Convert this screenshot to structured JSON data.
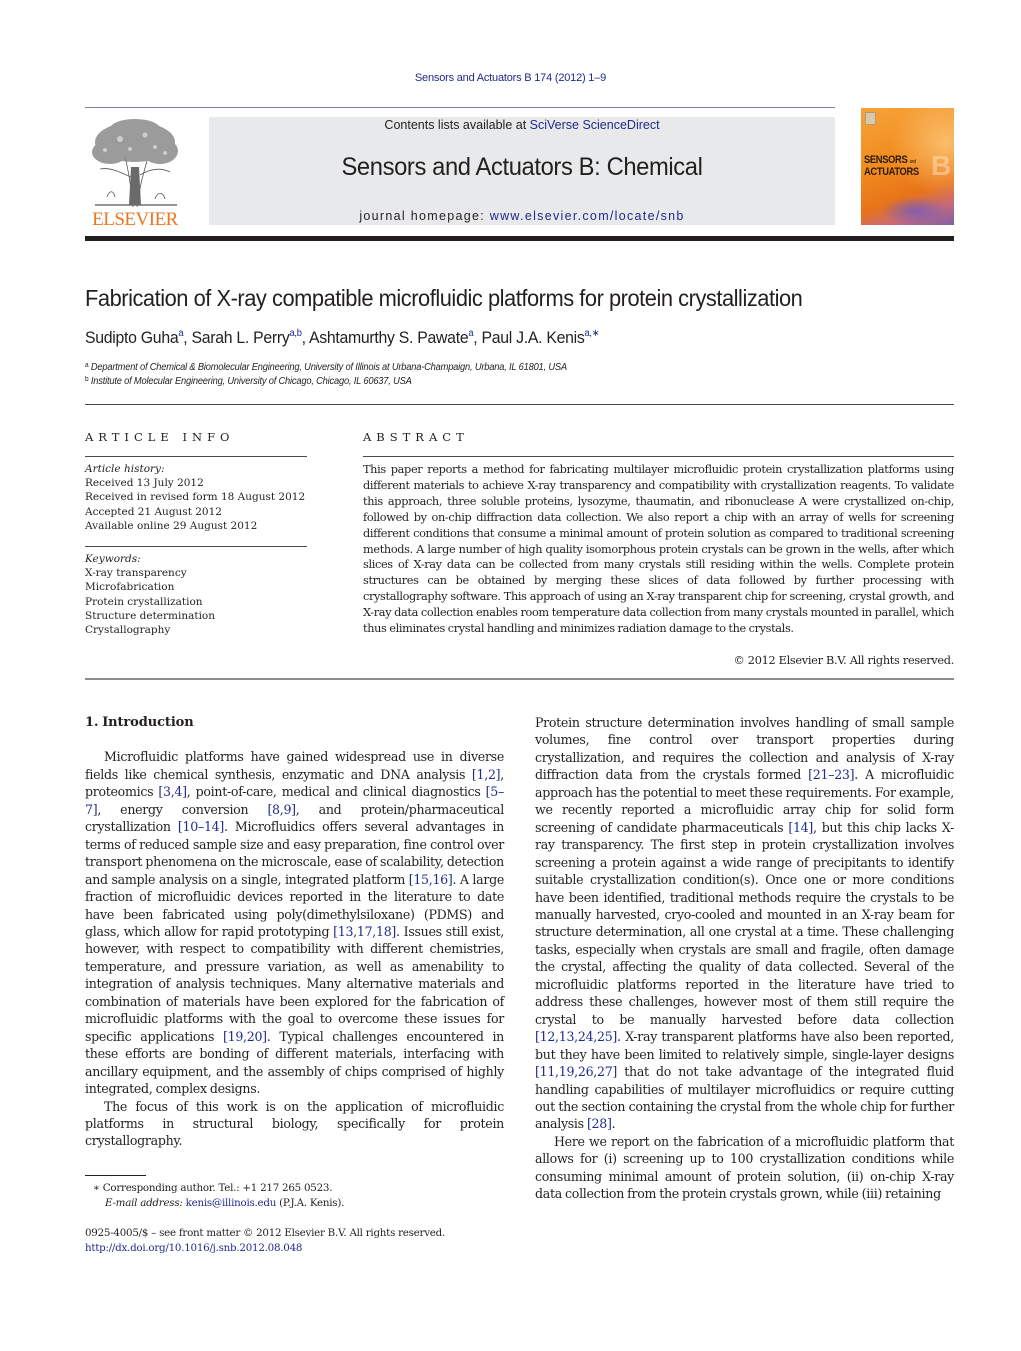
{
  "header": {
    "citation": "Sensors and Actuators B 174 (2012) 1–9",
    "contents_prefix": "Contents lists available at ",
    "contents_link": "SciVerse ScienceDirect",
    "journal_title": "Sensors and Actuators B: Chemical",
    "homepage_prefix": "journal homepage: ",
    "homepage_link": "www.elsevier.com/locate/snb",
    "publisher_logo_text": "ELSEVIER",
    "cover": {
      "line1": "SENSORS",
      "and": "and",
      "line2": "ACTUATORS",
      "letter": "B"
    },
    "colors": {
      "link": "#1f2b8c",
      "elsevier_orange": "#e87722",
      "banner_bg": "#e8e9ea"
    }
  },
  "article": {
    "title": "Fabrication of X-ray compatible microfluidic platforms for protein crystallization",
    "authors": [
      {
        "name": "Sudipto Guha",
        "sup": "a"
      },
      {
        "name": "Sarah L. Perry",
        "sup": "a,b"
      },
      {
        "name": "Ashtamurthy S. Pawate",
        "sup": "a"
      },
      {
        "name": "Paul J.A. Kenis",
        "sup": "a,∗"
      }
    ],
    "affiliations": [
      {
        "mark": "a",
        "text": "Department of Chemical & Biomolecular Engineering, University of Illinois at Urbana-Champaign, Urbana, IL 61801, USA"
      },
      {
        "mark": "b",
        "text": "Institute of Molecular Engineering, University of Chicago, Chicago, IL 60637, USA"
      }
    ]
  },
  "article_info": {
    "heading": "ARTICLE INFO",
    "history_label": "Article history:",
    "history": [
      "Received 13 July 2012",
      "Received in revised form 18 August 2012",
      "Accepted 21 August 2012",
      "Available online 29 August 2012"
    ],
    "keywords_label": "Keywords:",
    "keywords": [
      "X-ray transparency",
      "Microfabrication",
      "Protein crystallization",
      "Structure determination",
      "Crystallography"
    ]
  },
  "abstract": {
    "heading": "ABSTRACT",
    "text": "This paper reports a method for fabricating multilayer microfluidic protein crystallization platforms using different materials to achieve X-ray transparency and compatibility with crystallization reagents. To validate this approach, three soluble proteins, lysozyme, thaumatin, and ribonuclease A were crystallized on-chip, followed by on-chip diffraction data collection. We also report a chip with an array of wells for screening different conditions that consume a minimal amount of protein solution as compared to traditional screening methods. A large number of high quality isomorphous protein crystals can be grown in the wells, after which slices of X-ray data can be collected from many crystals still residing within the wells. Complete protein structures can be obtained by merging these slices of data followed by further processing with crystallography software. This approach of using an X-ray transparent chip for screening, crystal growth, and X-ray data collection enables room temperature data collection from many crystals mounted in parallel, which thus eliminates crystal handling and minimizes radiation damage to the crystals.",
    "copyright": "© 2012 Elsevier B.V. All rights reserved."
  },
  "body": {
    "section1_heading": "1.  Introduction",
    "left": {
      "p1": [
        {
          "t": "Microfluidic platforms have gained widespread use in diverse fields like chemical synthesis, enzymatic and DNA analysis "
        },
        {
          "c": "[1,2]"
        },
        {
          "t": ", proteomics "
        },
        {
          "c": "[3,4]"
        },
        {
          "t": ", point-of-care, medical and clinical diagnostics "
        },
        {
          "c": "[5–7]"
        },
        {
          "t": ", energy conversion "
        },
        {
          "c": "[8,9]"
        },
        {
          "t": ", and protein/pharmaceutical crystallization "
        },
        {
          "c": "[10–14]"
        },
        {
          "t": ". Microfluidics offers several advantages in terms of reduced sample size and easy preparation, fine control over transport phenomena on the microscale, ease of scalability, detection and sample analysis on a single, integrated platform "
        },
        {
          "c": "[15,16]"
        },
        {
          "t": ". A large fraction of microfluidic devices reported in the literature to date have been fabricated using poly(dimethylsiloxane) (PDMS) and glass, which allow for rapid prototyping "
        },
        {
          "c": "[13,17,18]"
        },
        {
          "t": ". Issues still exist, however, with respect to compatibility with different chemistries, temperature, and pressure variation, as well as amenability to integration of analysis techniques. Many alternative materials and combination of materials have been explored for the fabrication of microfluidic platforms with the goal to overcome these issues for specific applications "
        },
        {
          "c": "[19,20]"
        },
        {
          "t": ". Typical challenges encountered in these efforts are bonding of different materials, interfacing with ancillary equipment, and the assembly of chips comprised of highly integrated, complex designs."
        }
      ],
      "p2": [
        {
          "t": "The focus of this work is on the application of microfluidic platforms in structural biology, specifically for protein crystallography."
        }
      ]
    },
    "right": {
      "p1": [
        {
          "t": "Protein structure determination involves handling of small sample volumes, fine control over transport properties during crystallization, and requires the collection and analysis of X-ray diffraction data from the crystals formed "
        },
        {
          "c": "[21–23]"
        },
        {
          "t": ". A microfluidic approach has the potential to meet these requirements. For example, we recently reported a microfluidic array chip for solid form screening of candidate pharmaceuticals "
        },
        {
          "c": "[14]"
        },
        {
          "t": ", but this chip lacks X-ray transparency. The first step in protein crystallization involves screening a protein against a wide range of precipitants to identify suitable crystallization condition(s). Once one or more conditions have been identified, traditional methods require the crystals to be manually harvested, cryo-cooled and mounted in an X-ray beam for structure determination, all one crystal at a time. These challenging tasks, especially when crystals are small and fragile, often damage the crystal, affecting the quality of data collected. Several of the microfluidic platforms reported in the literature have tried to address these challenges, however most of them still require the crystal to be manually harvested before data collection "
        },
        {
          "c": "[12,13,24,25]"
        },
        {
          "t": ". X-ray transparent platforms have also been reported, but they have been limited to relatively simple, single-layer designs "
        },
        {
          "c": "[11,19,26,27]"
        },
        {
          "t": " that do not take advantage of the integrated fluid handling capabilities of multilayer microfluidics or require cutting out the section containing the crystal from the whole chip for further analysis "
        },
        {
          "c": "[28]"
        },
        {
          "t": "."
        }
      ],
      "p2": [
        {
          "t": "Here we report on the fabrication of a microfluidic platform that allows for (i) screening up to 100 crystallization conditions while consuming minimal amount of protein solution, (ii) on-chip X-ray data collection from the protein crystals grown, while (iii) retaining"
        }
      ]
    }
  },
  "footnotes": {
    "star": "∗",
    "corresponding": "Corresponding author. Tel.: +1 217 265 0523.",
    "email_label": "E-mail address:",
    "email": "kenis@illinois.edu",
    "email_suffix": " (P.J.A. Kenis).",
    "issn_line": "0925-4005/$ – see front matter © 2012 Elsevier B.V. All rights reserved.",
    "doi": "http://dx.doi.org/10.1016/j.snb.2012.08.048"
  }
}
